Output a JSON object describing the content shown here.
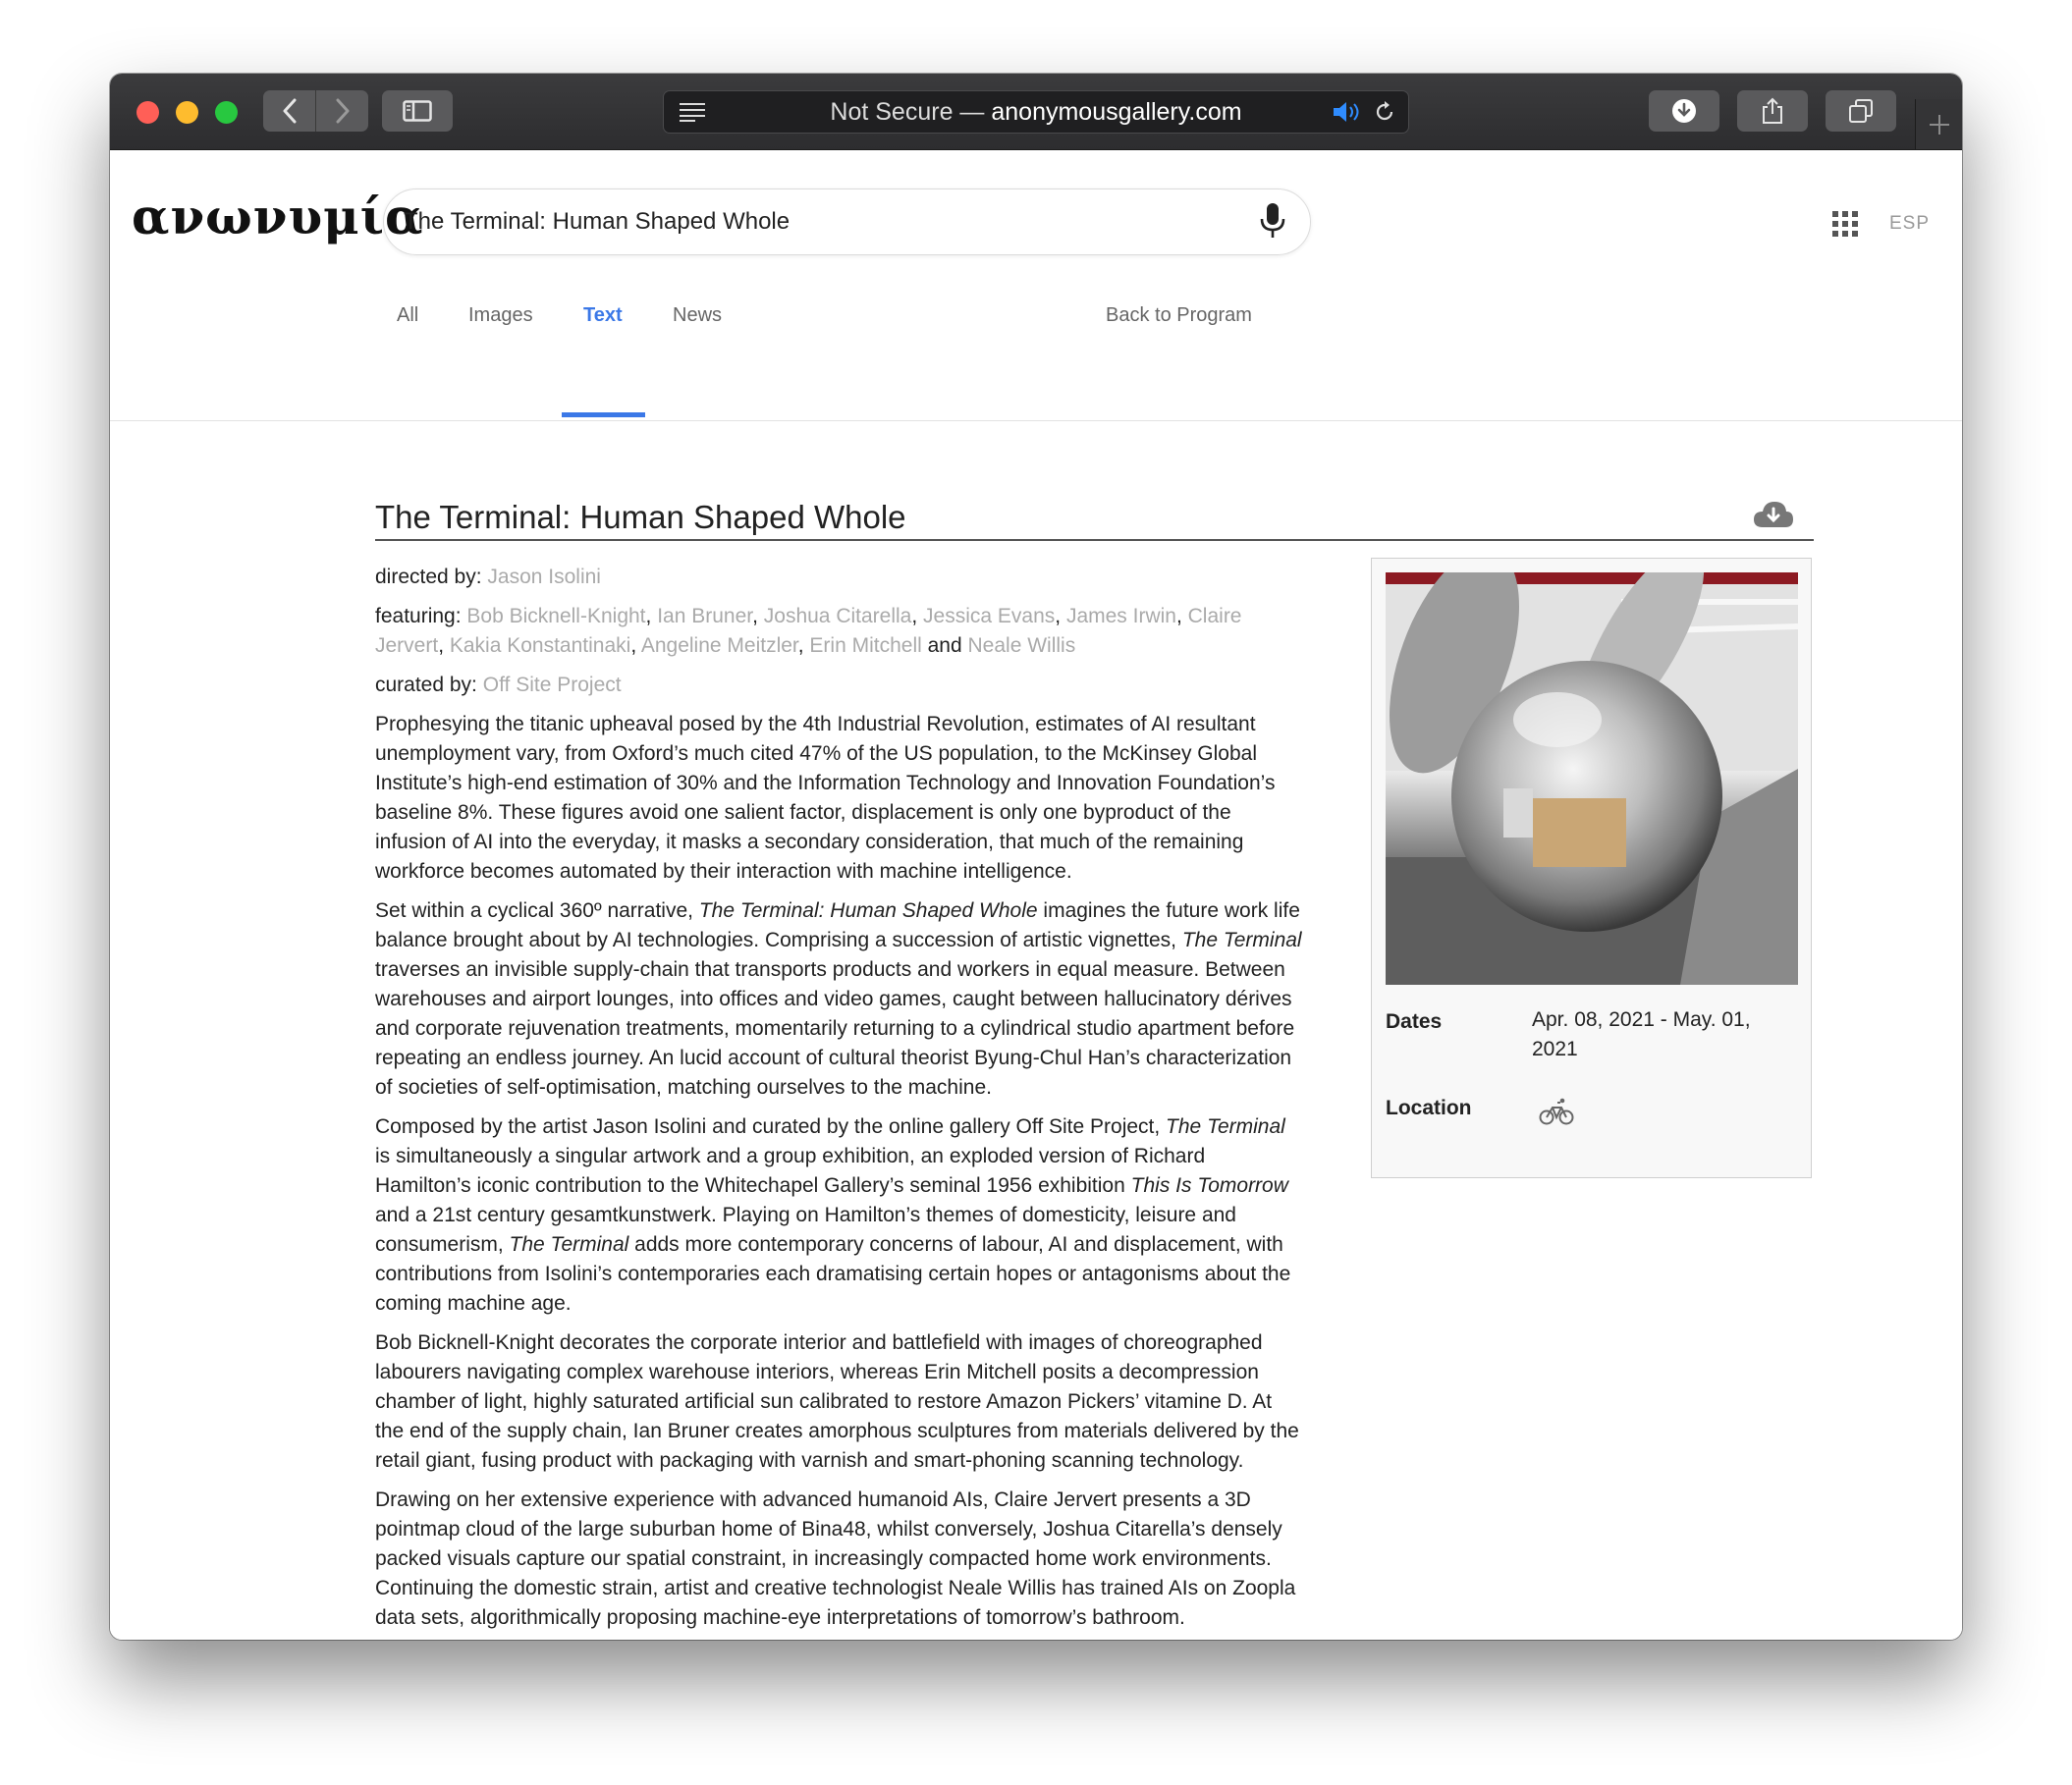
{
  "browser": {
    "url_prefix": "Not Secure — ",
    "url_domain": "anonymousgallery.com"
  },
  "site": {
    "logo": "ανωνυμία",
    "search_query": "The Terminal: Human Shaped Whole",
    "language_toggle": "ESP"
  },
  "tabs": [
    {
      "label": "All",
      "active": false
    },
    {
      "label": "Images",
      "active": false
    },
    {
      "label": "Text",
      "active": true
    },
    {
      "label": "News",
      "active": false
    }
  ],
  "back_link": "Back to Program",
  "article": {
    "title": "The Terminal: Human Shaped Whole",
    "directed_by_label": "directed by:",
    "director": "Jason Isolini",
    "featuring_label": "featuring:",
    "featuring": [
      "Bob Bicknell-Knight",
      "Ian Bruner",
      "Joshua Citarella",
      "Jessica Evans",
      "James Irwin",
      "Claire Jervert",
      "Kakia Konstantinaki",
      "Angeline Meitzler",
      "Erin Mitchell",
      "Neale Willis"
    ],
    "and_word": "and",
    "curated_by_label": "curated by:",
    "curator": "Off Site Project",
    "p1": "Prophesying the titanic upheaval posed by the 4th Industrial Revolution, estimates of AI resultant unemployment vary, from Oxford’s much cited 47% of the US population, to the McKinsey Global Institute’s high-end estimation of 30% and the Information Technology and Innovation Foundation’s baseline 8%. These figures avoid one salient factor, displacement is only one byproduct of the infusion of AI into the everyday, it masks a secondary consideration, that much of the remaining workforce becomes automated by their interaction with machine intelligence.",
    "p2": [
      {
        "t": "Set within a cyclical 360º narrative, ",
        "i": false
      },
      {
        "t": "The Terminal: Human Shaped Whole",
        "i": true
      },
      {
        "t": " imagines the future work life balance brought about by AI technologies. Comprising a succession of artistic vignettes, ",
        "i": false
      },
      {
        "t": "The Terminal",
        "i": true
      },
      {
        "t": " traverses an invisible supply-chain that transports products and workers in equal measure. Between warehouses and airport lounges, into offices and video games, caught between hallucinatory dérives and corporate rejuvenation treatments, momentarily returning to a cylindrical studio apartment before repeating an endless journey. An lucid account of cultural theorist Byung-Chul Han’s characterization of societies of self-optimisation, matching ourselves to the machine.",
        "i": false
      }
    ],
    "p3": [
      {
        "t": "Composed by the artist Jason Isolini and curated by the online gallery Off Site Project, ",
        "i": false
      },
      {
        "t": "The Terminal",
        "i": true
      },
      {
        "t": " is simultaneously a singular artwork and a group exhibition, an exploded version of Richard Hamilton’s iconic contribution to the Whitechapel Gallery’s seminal 1956 exhibition ",
        "i": false
      },
      {
        "t": "This Is Tomorrow",
        "i": true
      },
      {
        "t": " and a 21st century gesamtkunstwerk. Playing on Hamilton’s themes of domesticity, leisure and consumerism, ",
        "i": false
      },
      {
        "t": "The Terminal",
        "i": true
      },
      {
        "t": " adds more contemporary concerns of labour, AI and displacement, with contributions from Isolini’s contemporaries each dramatising certain hopes or antagonisms about the coming machine age.",
        "i": false
      }
    ],
    "p4": "Bob Bicknell-Knight decorates the corporate interior and battlefield with images of choreographed labourers navigating complex warehouse interiors, whereas Erin Mitchell posits a decompression chamber of light, highly saturated artificial sun calibrated to restore Amazon Pickers’ vitamine D. At the end of the supply chain, Ian Bruner creates amorphous sculptures from materials delivered by the retail giant, fusing product with packaging with varnish and smart-phoning scanning technology.",
    "p5": "Drawing on her extensive experience with advanced humanoid AIs, Claire Jervert presents a 3D pointmap cloud of the large suburban home of Bina48, whilst conversely, Joshua Citarella’s densely packed visuals capture our spatial constraint, in increasingly compacted home work environments. Continuing the domestic strain, artist and creative technologist Neale Willis has trained AIs on Zoopla data sets, algorithmically proposing machine-eye interpretations of tomorrow’s bathroom."
  },
  "infobox": {
    "dates_label": "Dates",
    "dates_value": "Apr. 08, 2021 - May. 01, 2021",
    "location_label": "Location",
    "location_icon": "bicycle-icon"
  },
  "colors": {
    "accent": "#3b78e7",
    "muted_link": "#aaaaaa"
  }
}
